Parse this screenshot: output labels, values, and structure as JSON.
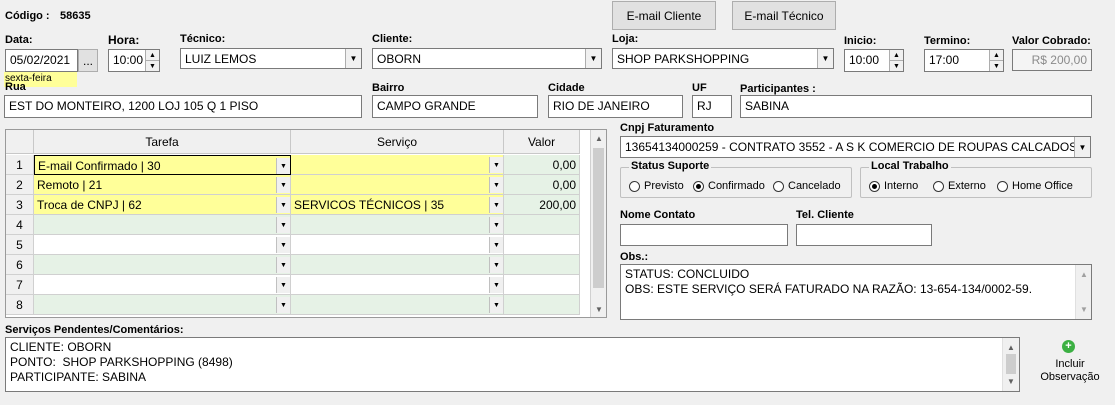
{
  "codigo": {
    "label": "Código :",
    "value": "58635"
  },
  "buttons": {
    "email_cliente": "E-mail Cliente",
    "email_tecnico": "E-mail Técnico",
    "dots": "...",
    "incluir_observacao": "Incluir Observação"
  },
  "data": {
    "label": "Data:",
    "value": "05/02/2021",
    "weekday": "sexta-feira"
  },
  "hora": {
    "label": "Hora:",
    "value": "10:00"
  },
  "tecnico": {
    "label": "Técnico:",
    "value": "LUIZ LEMOS"
  },
  "cliente": {
    "label": "Cliente:",
    "value": "OBORN"
  },
  "loja": {
    "label": "Loja:",
    "value": "SHOP PARKSHOPPING"
  },
  "inicio": {
    "label": "Inicio:",
    "value": "10:00"
  },
  "termino": {
    "label": "Termino:",
    "value": "17:00"
  },
  "valor_cobrado": {
    "label": "Valor Cobrado:",
    "value": "R$ 200,00"
  },
  "rua": {
    "label": "Rua",
    "value": "EST DO MONTEIRO, 1200 LOJ 105 Q 1 PISO"
  },
  "bairro": {
    "label": "Bairro",
    "value": "CAMPO GRANDE"
  },
  "cidade": {
    "label": "Cidade",
    "value": "RIO DE JANEIRO"
  },
  "uf": {
    "label": "UF",
    "value": "RJ"
  },
  "participantes": {
    "label": "Participantes :",
    "value": "SABINA"
  },
  "grid": {
    "headers": {
      "tarefa": "Tarefa",
      "servico": "Serviço",
      "valor": "Valor"
    },
    "rows": [
      {
        "num": "1",
        "tarefa": "E-mail Confirmado | 30",
        "servico": "",
        "valor": "0,00"
      },
      {
        "num": "2",
        "tarefa": "Remoto | 21",
        "servico": "",
        "valor": "0,00"
      },
      {
        "num": "3",
        "tarefa": "Troca de CNPJ | 62",
        "servico": "SERVICOS TÉCNICOS | 35",
        "valor": "200,00"
      },
      {
        "num": "4",
        "tarefa": "",
        "servico": "",
        "valor": ""
      },
      {
        "num": "5",
        "tarefa": "",
        "servico": "",
        "valor": ""
      },
      {
        "num": "6",
        "tarefa": "",
        "servico": "",
        "valor": ""
      },
      {
        "num": "7",
        "tarefa": "",
        "servico": "",
        "valor": ""
      },
      {
        "num": "8",
        "tarefa": "",
        "servico": "",
        "valor": ""
      }
    ]
  },
  "cnpj": {
    "label": "Cnpj Faturamento",
    "value": "13654134000259 - CONTRATO 3552 - A S K COMERCIO DE ROUPAS CALCADOS"
  },
  "status_suporte": {
    "title": "Status Suporte",
    "options": [
      "Previsto",
      "Confirmado",
      "Cancelado"
    ],
    "selected": "Confirmado"
  },
  "local_trabalho": {
    "title": "Local Trabalho",
    "options": [
      "Interno",
      "Externo",
      "Home Office"
    ],
    "selected": "Interno"
  },
  "nome_contato": {
    "label": "Nome Contato",
    "value": ""
  },
  "tel_cliente": {
    "label": "Tel. Cliente",
    "value": ""
  },
  "obs": {
    "label": "Obs.:",
    "line1": "STATUS: CONCLUIDO",
    "line2": "OBS: ESTE SERVIÇO SERÁ FATURADO NA RAZÃO: 13-654-134/0002-59."
  },
  "pendentes": {
    "label": "Serviços Pendentes/Comentários:",
    "line1": "CLIENTE: OBORN",
    "line2": "PONTO:  SHOP PARKSHOPPING (8498)",
    "line3": "PARTICIPANTE: SABINA"
  },
  "colors": {
    "yellow": "#ffff99",
    "green_row": "#e6f2e6",
    "weekday_bg": "#ffff99",
    "add_icon": "#3cb043"
  }
}
